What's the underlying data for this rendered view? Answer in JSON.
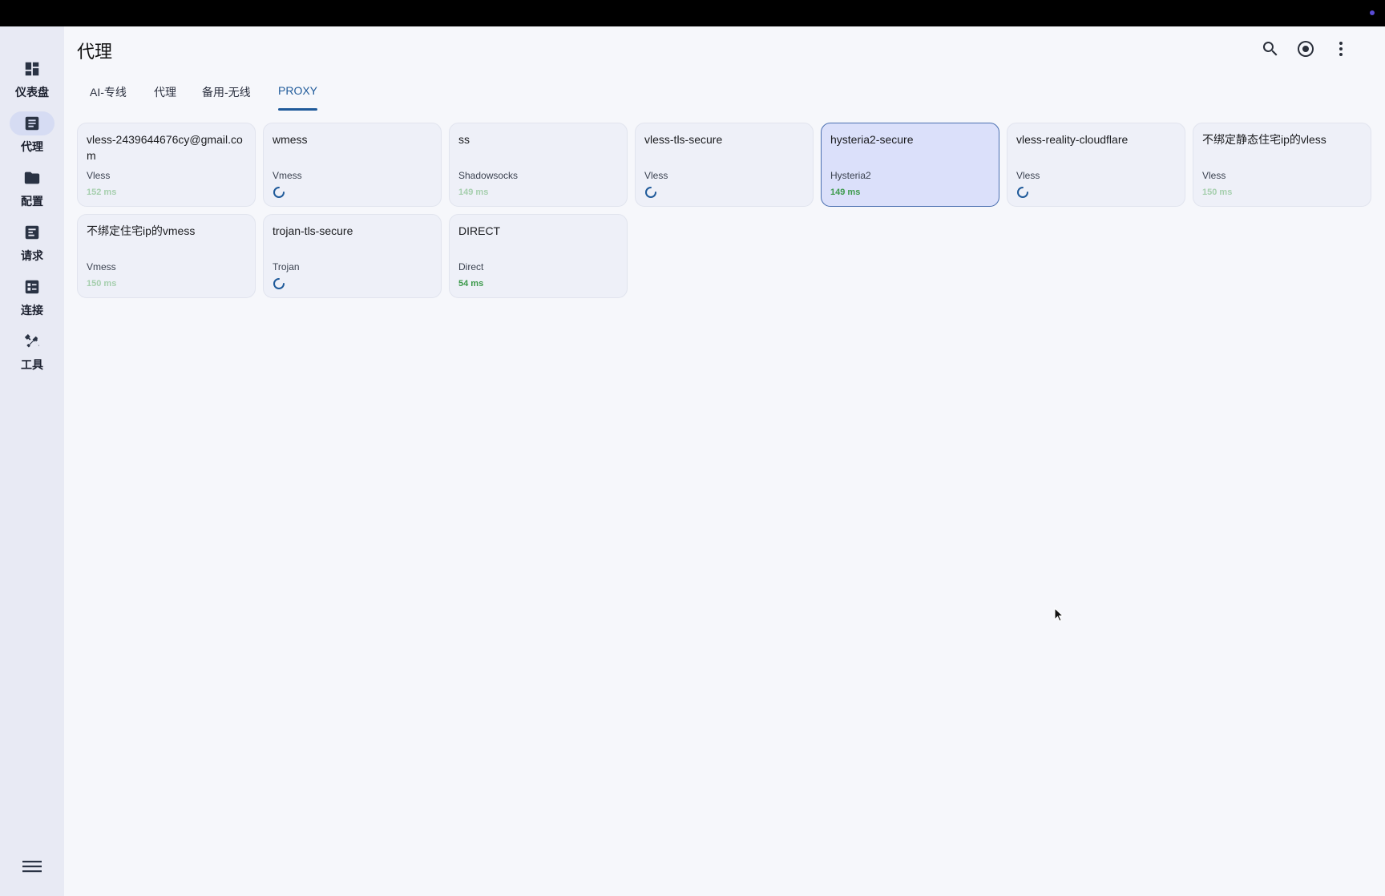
{
  "app": {
    "title": "代理"
  },
  "nav": {
    "items": [
      {
        "label": "仪表盘",
        "icon": "dashboard-icon"
      },
      {
        "label": "代理",
        "icon": "article-icon"
      },
      {
        "label": "配置",
        "icon": "folder-icon"
      },
      {
        "label": "请求",
        "icon": "notes-icon"
      },
      {
        "label": "连接",
        "icon": "list-icon"
      },
      {
        "label": "工具",
        "icon": "tools-icon"
      }
    ],
    "active": "代理",
    "menu_icon": "menu-icon"
  },
  "actions": [
    {
      "icon": "search-icon"
    },
    {
      "icon": "target-icon"
    },
    {
      "icon": "more-vert-icon"
    }
  ],
  "tabs": [
    "AI-专线",
    "代理",
    "备用-无线",
    "PROXY"
  ],
  "active_tab": "PROXY",
  "proxies": [
    {
      "name": "vless-2439644676cy@gmail.com",
      "type": "Vless",
      "delay": "152 ms",
      "state": "faded"
    },
    {
      "name": "wmess",
      "type": "Vmess",
      "delay": "",
      "state": "loading"
    },
    {
      "name": "ss",
      "type": "Shadowsocks",
      "delay": "149 ms",
      "state": "faded"
    },
    {
      "name": "vless-tls-secure",
      "type": "Vless",
      "delay": "",
      "state": "loading"
    },
    {
      "name": "hysteria2-secure",
      "type": "Hysteria2",
      "delay": "149 ms",
      "state": "ok",
      "selected": true
    },
    {
      "name": "vless-reality-cloudflare",
      "type": "Vless",
      "delay": "",
      "state": "loading"
    },
    {
      "name": "不绑定静态住宅ip的vless",
      "type": "Vless",
      "delay": "150 ms",
      "state": "faded"
    },
    {
      "name": "不绑定住宅ip的vmess",
      "type": "Vmess",
      "delay": "150 ms",
      "state": "faded"
    },
    {
      "name": "trojan-tls-secure",
      "type": "Trojan",
      "delay": "",
      "state": "loading"
    },
    {
      "name": "DIRECT",
      "type": "Direct",
      "delay": "54 ms",
      "state": "ok"
    }
  ],
  "colors": {
    "accent": "#1f5a9a",
    "delay_ok": "#3d9a4c",
    "delay_faded": "#a6cfae",
    "selected_bg": "#dbe0fa"
  }
}
